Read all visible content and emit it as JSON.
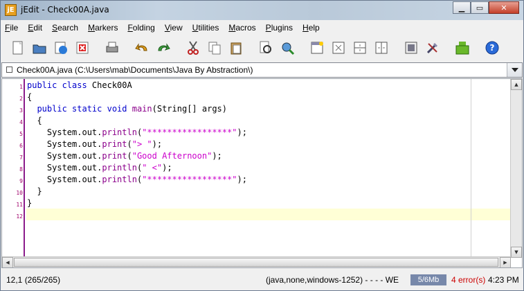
{
  "window": {
    "app_icon": "jE",
    "title": "jEdit - Check00A.java"
  },
  "menu": [
    {
      "key": "F",
      "rest": "ile"
    },
    {
      "key": "E",
      "rest": "dit"
    },
    {
      "key": "S",
      "rest": "earch"
    },
    {
      "key": "M",
      "rest": "arkers"
    },
    {
      "key": "F",
      "rest": "olding"
    },
    {
      "key": "V",
      "rest": "iew"
    },
    {
      "key": "U",
      "rest": "tilities"
    },
    {
      "key": "M",
      "rest": "acros"
    },
    {
      "key": "P",
      "rest": "lugins"
    },
    {
      "key": "H",
      "rest": "elp"
    }
  ],
  "toolbar_icons": [
    "new-file-icon",
    "open-file-icon",
    "reload-icon",
    "close-file-icon",
    "print-icon",
    "undo-icon",
    "redo-icon",
    "cut-icon",
    "copy-icon",
    "paste-icon",
    "find-icon",
    "find-next-icon",
    "new-view-icon",
    "unsplit-icon",
    "split-horizontal-icon",
    "split-vertical-icon",
    "buffer-options-icon",
    "global-options-icon",
    "plugin-manager-icon",
    "help-icon"
  ],
  "buffer": {
    "label": "Check00A.java (C:\\Users\\mab\\Documents\\Java By Abstraction\\)"
  },
  "code": {
    "line_numbers": [
      "1",
      "2",
      "3",
      "4",
      "5",
      "6",
      "7",
      "8",
      "9",
      "10",
      "11",
      "12"
    ],
    "lines": [
      [
        {
          "t": "public class ",
          "c": "kw"
        },
        {
          "t": "Check00A",
          "c": ""
        }
      ],
      [
        {
          "t": "{",
          "c": ""
        }
      ],
      [
        {
          "t": "  public static void ",
          "c": "kw"
        },
        {
          "t": "main",
          "c": "fn"
        },
        {
          "t": "(String[] args)",
          "c": ""
        }
      ],
      [
        {
          "t": "  {",
          "c": ""
        }
      ],
      [
        {
          "t": "    System.out.",
          "c": ""
        },
        {
          "t": "println",
          "c": "fn"
        },
        {
          "t": "(",
          "c": ""
        },
        {
          "t": "\"*****************\"",
          "c": "str"
        },
        {
          "t": ");",
          "c": ""
        }
      ],
      [
        {
          "t": "    System.out.",
          "c": ""
        },
        {
          "t": "print",
          "c": "fn"
        },
        {
          "t": "(",
          "c": ""
        },
        {
          "t": "\"> \"",
          "c": "str"
        },
        {
          "t": ");",
          "c": ""
        }
      ],
      [
        {
          "t": "    System.out.",
          "c": ""
        },
        {
          "t": "print",
          "c": "fn"
        },
        {
          "t": "(",
          "c": ""
        },
        {
          "t": "\"Good Afternoon\"",
          "c": "str"
        },
        {
          "t": ");",
          "c": ""
        }
      ],
      [
        {
          "t": "    System.out.",
          "c": ""
        },
        {
          "t": "println",
          "c": "fn"
        },
        {
          "t": "(",
          "c": ""
        },
        {
          "t": "\" <\"",
          "c": "str"
        },
        {
          "t": ");",
          "c": ""
        }
      ],
      [
        {
          "t": "    System.out.",
          "c": ""
        },
        {
          "t": "println",
          "c": "fn"
        },
        {
          "t": "(",
          "c": ""
        },
        {
          "t": "\"*****************\"",
          "c": "str"
        },
        {
          "t": ");",
          "c": ""
        }
      ],
      [
        {
          "t": "  }",
          "c": ""
        }
      ],
      [
        {
          "t": "}",
          "c": ""
        }
      ],
      [
        {
          "t": "",
          "c": ""
        }
      ]
    ]
  },
  "status": {
    "caret": "12,1 (265/265)",
    "mode": "(java,none,windows-1252) - - - - WE",
    "memory": "5/6Mb",
    "errors": "4 error(s)",
    "time": "4:23 PM"
  },
  "colors": {
    "keyword": "#0000cc",
    "method": "#8b008b",
    "string": "#cc00cc",
    "gutter_border": "#8b1a8b",
    "current_line": "#ffffd6",
    "error": "#cc0000"
  }
}
